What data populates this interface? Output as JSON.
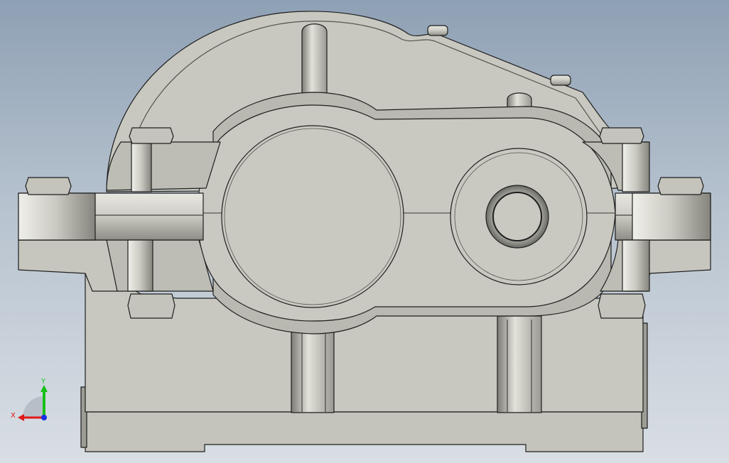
{
  "viewport": {
    "background_top": "#8ea0b4",
    "background_bottom": "#d9dee4",
    "part_fill": "#c8c8c0",
    "part_shade": "#a8a89f",
    "edge_color": "#1e1e1e"
  },
  "triad": {
    "x_label": "X",
    "y_label": "Y",
    "x_color": "#e01818",
    "y_color": "#18c018",
    "z_color": "#1830e0"
  }
}
